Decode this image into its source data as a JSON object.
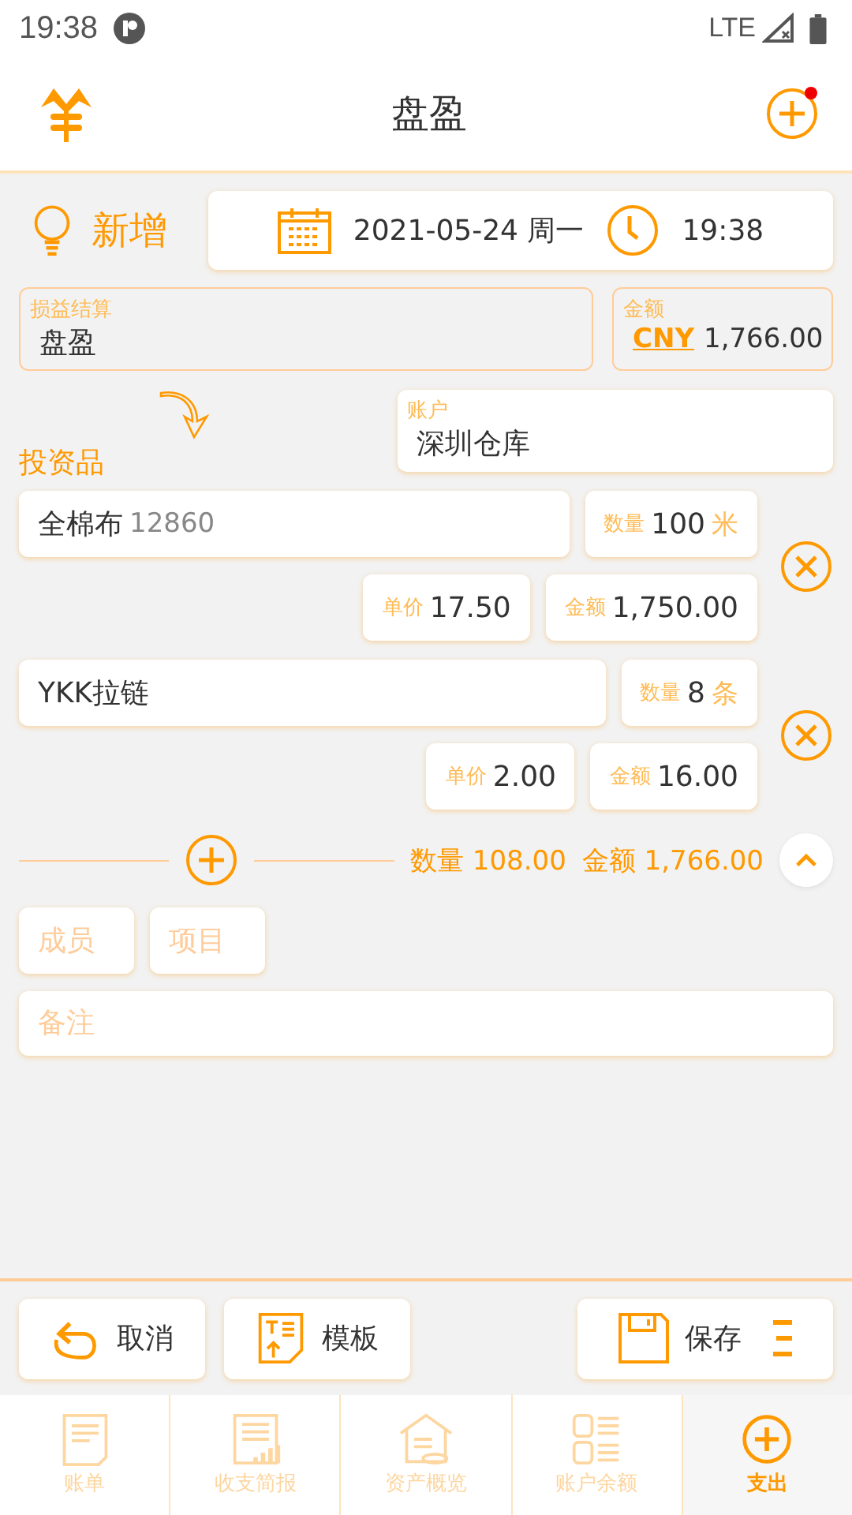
{
  "status_bar": {
    "time": "19:38",
    "network": "LTE"
  },
  "header": {
    "title": "盘盈",
    "notification": true
  },
  "entry": {
    "mode": "新增",
    "date": "2021-05-24 周一",
    "time": "19:38"
  },
  "category": {
    "label": "损益结算",
    "value": "盘盈"
  },
  "amount": {
    "label": "金额",
    "currency": "CNY",
    "value": "1,766.00"
  },
  "account": {
    "label": "账户",
    "value": "深圳仓库"
  },
  "section_title": "投资品",
  "items": [
    {
      "name": "全棉布",
      "code": "12860",
      "qty_label": "数量",
      "qty": "100",
      "unit": "米",
      "price_label": "单价",
      "price": "17.50",
      "amount_label": "金额",
      "amount": "1,750.00"
    },
    {
      "name": "YKK拉链",
      "qty_label": "数量",
      "qty": "8",
      "unit": "条",
      "price_label": "单价",
      "price": "2.00",
      "amount_label": "金额",
      "amount": "16.00"
    }
  ],
  "totals": {
    "qty_label": "数量",
    "qty": "108.00",
    "amount_label": "金额",
    "amount": "1,766.00"
  },
  "tags": [
    {
      "placeholder": "成员"
    },
    {
      "placeholder": "项目"
    }
  ],
  "note": {
    "placeholder": "备注"
  },
  "actions": [
    {
      "kind": "cancel",
      "label": "取消"
    },
    {
      "kind": "template",
      "label": "模板"
    },
    {
      "kind": "save",
      "label": "保存"
    }
  ],
  "nav": [
    {
      "kind": "bill",
      "label": "账单",
      "selected": false
    },
    {
      "kind": "report",
      "label": "收支简报",
      "selected": false
    },
    {
      "kind": "assets",
      "label": "资产概览",
      "selected": false
    },
    {
      "kind": "balance",
      "label": "账户余额",
      "selected": false
    },
    {
      "kind": "expense",
      "label": "支出",
      "selected": true
    }
  ]
}
